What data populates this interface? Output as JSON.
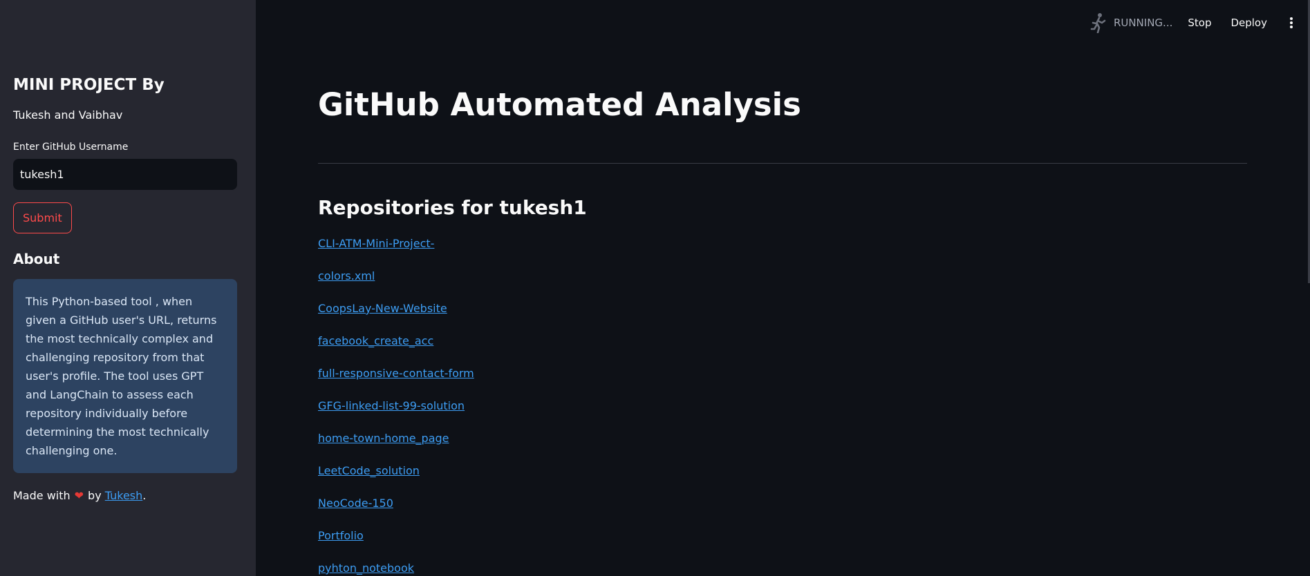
{
  "sidebar": {
    "title": "MINI PROJECT By",
    "authors": "Tukesh and Vaibhav",
    "username_label": "Enter GitHub Username",
    "username_value": "tukesh1",
    "submit_label": "Submit",
    "about_title": "About",
    "about_text": "This Python-based tool , when given a GitHub user's URL, returns the most technically complex and challenging repository from that user's profile. The tool uses GPT and LangChain to assess each repository individually before determining the most technically challenging one.",
    "made_with_prefix": "Made with",
    "made_with_by": "by",
    "author_link": "Tukesh",
    "made_with_suffix": "."
  },
  "topbar": {
    "status": "RUNNING...",
    "stop_label": "Stop",
    "deploy_label": "Deploy"
  },
  "main": {
    "title": "GitHub Automated Analysis",
    "repos_heading": "Repositories for tukesh1",
    "repos": [
      "CLI-ATM-Mini-Project-",
      "colors.xml",
      "CoopsLay-New-Website",
      "facebook_create_acc",
      "full-responsive-contact-form",
      "GFG-linked-list-99-solution",
      "home-town-home_page",
      "LeetCode_solution",
      "NeoCode-150",
      "Portfolio",
      "pyhton_notebook"
    ]
  },
  "colors": {
    "accent": "#ff4b4b",
    "link": "#3d9df3",
    "background": "#0e1117",
    "sidebar": "#262730",
    "info_box": "#2d4361"
  }
}
